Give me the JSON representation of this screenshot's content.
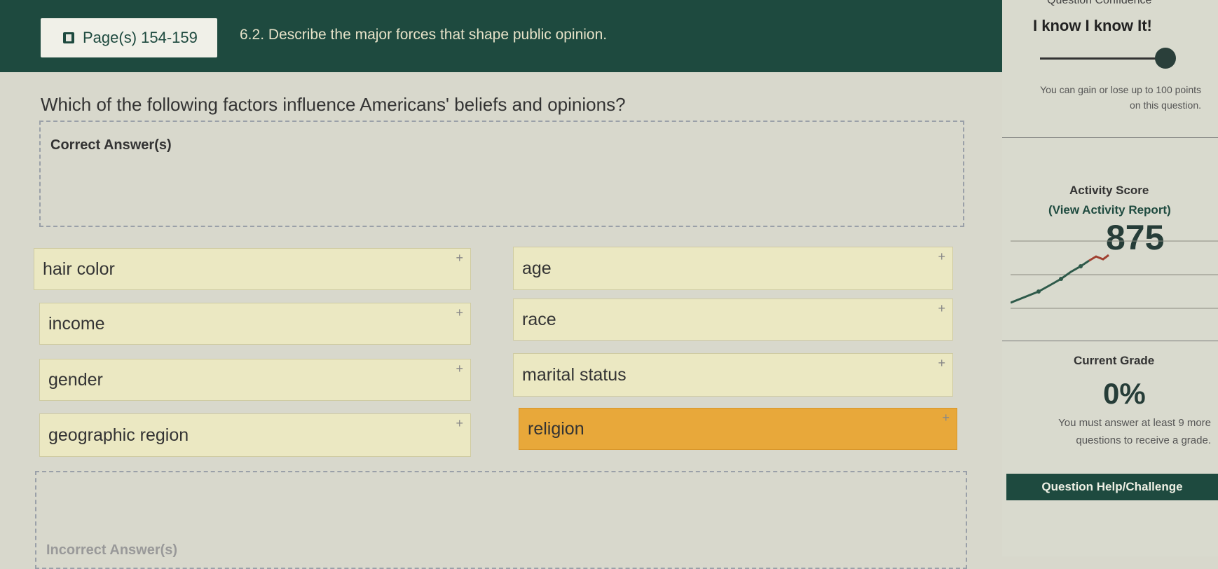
{
  "header": {
    "page_label": "Page(s) 154-159",
    "objective": "6.2. Describe the major forces that shape public opinion."
  },
  "confidence": {
    "label_top": "Question Confidence",
    "label": "I know I know It!",
    "points_note": "You can gain or lose up to 100 points on this question."
  },
  "activity": {
    "title": "Activity Score",
    "report_link": "(View Activity Report)",
    "score": "875"
  },
  "grade": {
    "title": "Current Grade",
    "value": "0%",
    "note": "You must answer at least 9 more questions to receive a grade."
  },
  "help_button": "Question Help/Challenge",
  "question": {
    "text": "Which of the following factors influence Americans' beliefs and opinions?",
    "correct_label": "Correct Answer(s)",
    "incorrect_label": "Incorrect Answer(s)",
    "options": [
      "hair color",
      "age",
      "income",
      "race",
      "gender",
      "marital status",
      "geographic region",
      "religion"
    ],
    "plus_glyph": "+"
  },
  "colors": {
    "brand": "#1e4a3f",
    "card": "#ebe8c2",
    "card_active": "#e8a83a"
  }
}
